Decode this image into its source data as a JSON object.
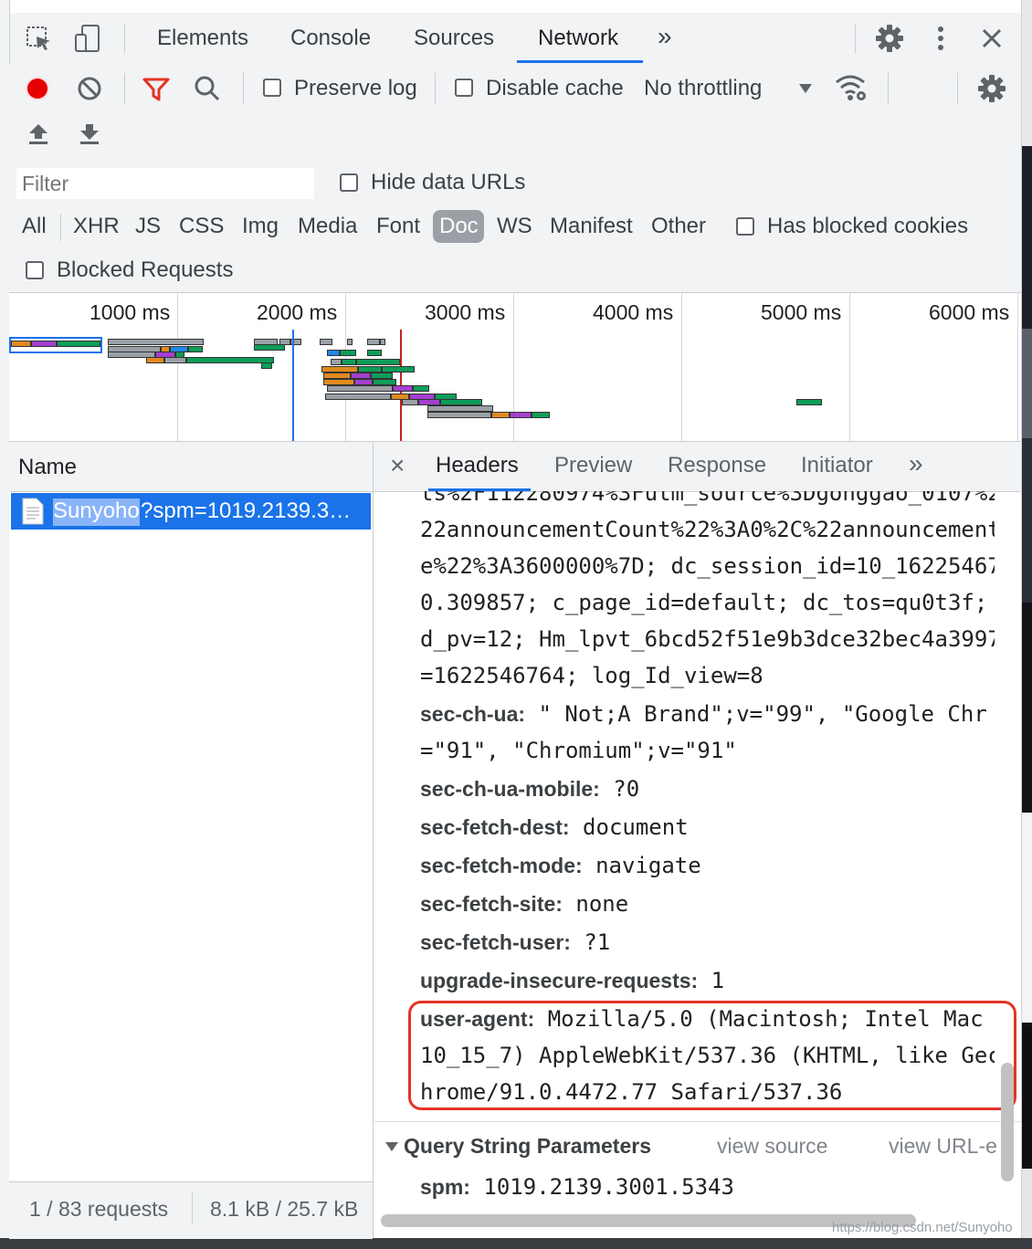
{
  "tabs": {
    "elements": "Elements",
    "console": "Console",
    "sources": "Sources",
    "network": "Network",
    "more": "»"
  },
  "toolbar": {
    "preserve_log": "Preserve log",
    "disable_cache": "Disable cache",
    "throttling": "No throttling"
  },
  "filter": {
    "placeholder": "Filter",
    "hide_data_urls": "Hide data URLs",
    "types": [
      "All",
      "XHR",
      "JS",
      "CSS",
      "Img",
      "Media",
      "Font",
      "Doc",
      "WS",
      "Manifest",
      "Other"
    ],
    "has_blocked_cookies": "Has blocked cookies",
    "blocked_requests": "Blocked Requests"
  },
  "timeline": {
    "ticks": [
      "1000 ms",
      "2000 ms",
      "3000 ms",
      "4000 ms",
      "5000 ms",
      "6000 ms"
    ]
  },
  "requests": {
    "column_name": "Name",
    "row_highlight": "Sunyoho",
    "row_rest": "?spm=1019.2139.3…"
  },
  "status": {
    "requests": "1 / 83 requests",
    "transferred": "8.1 kB / 25.7 kB"
  },
  "detail_tabs": {
    "close": "×",
    "headers": "Headers",
    "preview": "Preview",
    "response": "Response",
    "initiator": "Initiator",
    "more": "»"
  },
  "headers": {
    "cookie_lines": [
      "ts%2F112280974%3Futm_source%3Dgonggao_0107%2",
      "22announcementCount%22%3A0%2C%22announcement",
      "e%22%3A3600000%7D; dc_session_id=10_16225467",
      "0.309857; c_page_id=default; dc_tos=qu0t3f;",
      "d_pv=12; Hm_lpvt_6bcd52f51e9b3dce32bec4a3997",
      "=1622546764; log_Id_view=8"
    ],
    "sec_ch_ua": {
      "key": "sec-ch-ua:",
      "value": " \" Not;A Brand\";v=\"99\", \"Google Chr",
      "cont": "=\"91\", \"Chromium\";v=\"91\""
    },
    "sec_ch_ua_mobile": {
      "key": "sec-ch-ua-mobile:",
      "value": " ?0"
    },
    "sec_fetch_dest": {
      "key": "sec-fetch-dest:",
      "value": " document"
    },
    "sec_fetch_mode": {
      "key": "sec-fetch-mode:",
      "value": " navigate"
    },
    "sec_fetch_site": {
      "key": "sec-fetch-site:",
      "value": " none"
    },
    "sec_fetch_user": {
      "key": "sec-fetch-user:",
      "value": " ?1"
    },
    "upgrade_insecure": {
      "key": "upgrade-insecure-requests:",
      "value": " 1"
    },
    "user_agent": {
      "key": "user-agent:",
      "value": " Mozilla/5.0 (Macintosh; Intel Mac",
      "cont1": "10_15_7) AppleWebKit/537.36 (KHTML, like Gec",
      "cont2": "hrome/91.0.4472.77 Safari/537.36"
    }
  },
  "query_params": {
    "title": "Query String Parameters",
    "view_source": "view source",
    "view_url": "view URL-e",
    "spm_key": "spm:",
    "spm_value": " 1019.2139.3001.5343"
  },
  "watermark": "https://blog.csdn.net/Sunyoho",
  "colors": {
    "accent": "#1a73e8",
    "record": "#e50000",
    "filter_active": "#e53324",
    "highlight_box": "#e53324"
  }
}
